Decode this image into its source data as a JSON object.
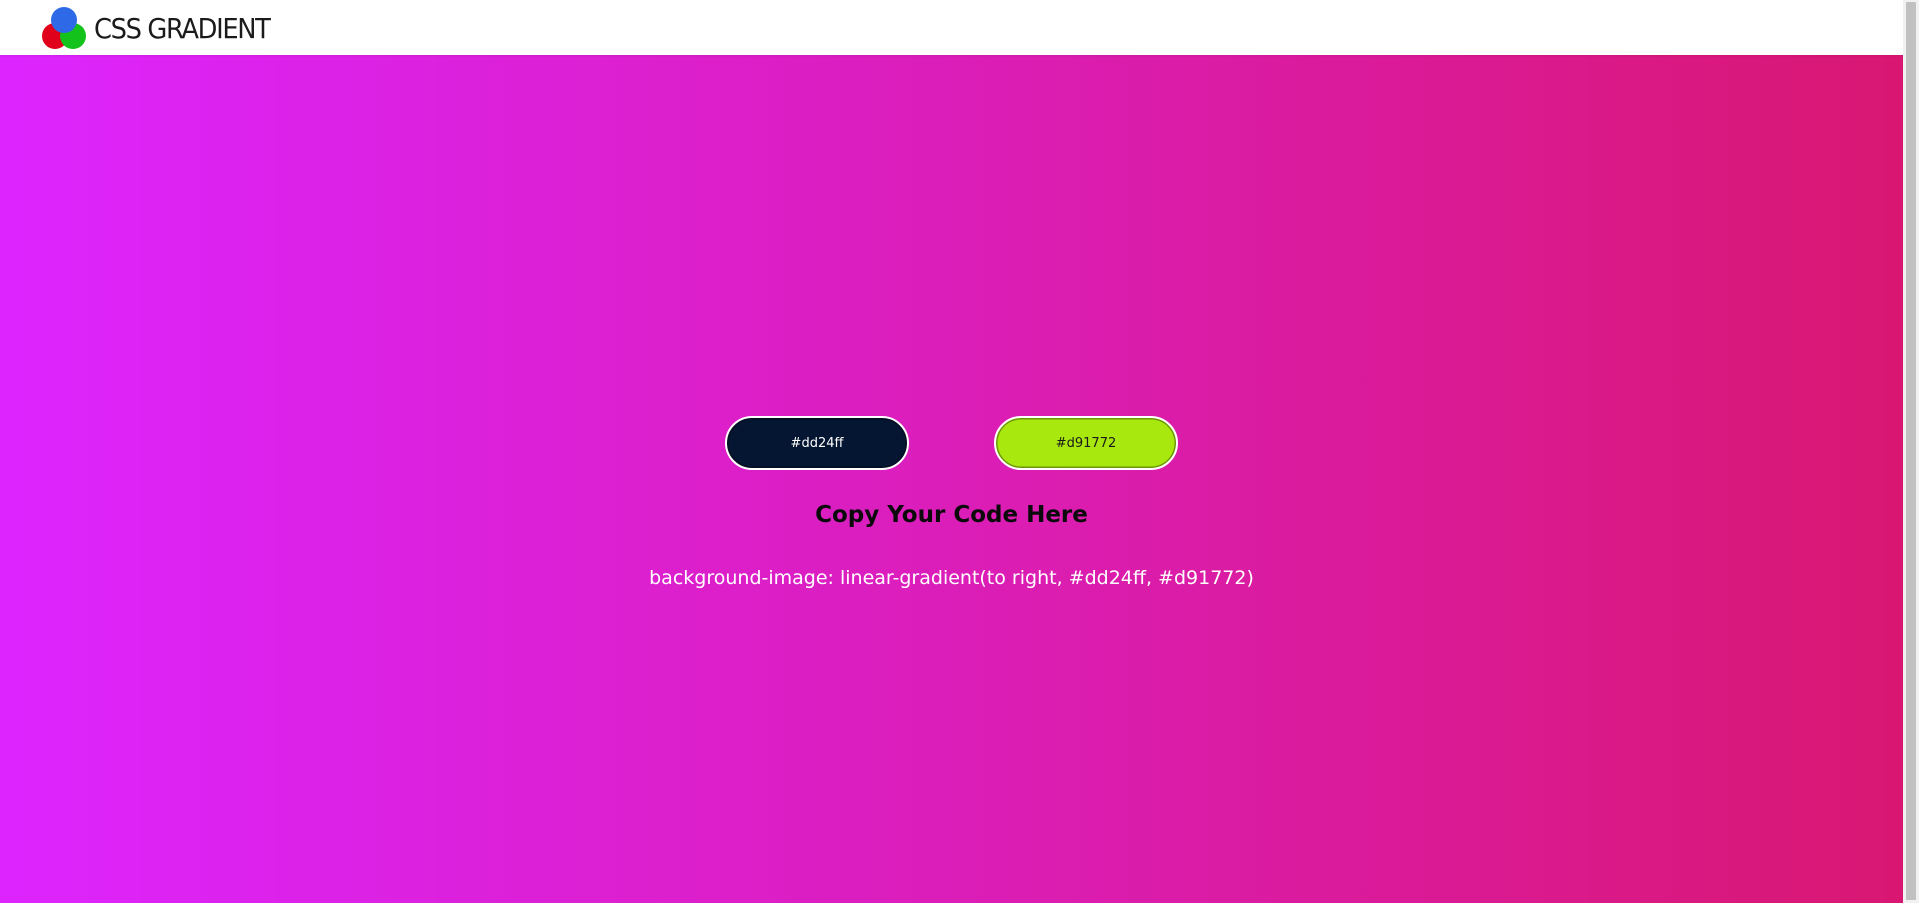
{
  "header": {
    "logo_text": "CSS GRADIENT"
  },
  "colors": {
    "gradient_start": "#dd24ff",
    "gradient_end": "#d91772",
    "pill_left_bg": "#051632",
    "pill_right_bg": "#a8e80f"
  },
  "pickers": {
    "color1_label": "#dd24ff",
    "color2_label": "#d91772"
  },
  "main": {
    "heading": "Copy Your Code Here",
    "code": "background-image: linear-gradient(to right, #dd24ff, #d91772)"
  }
}
